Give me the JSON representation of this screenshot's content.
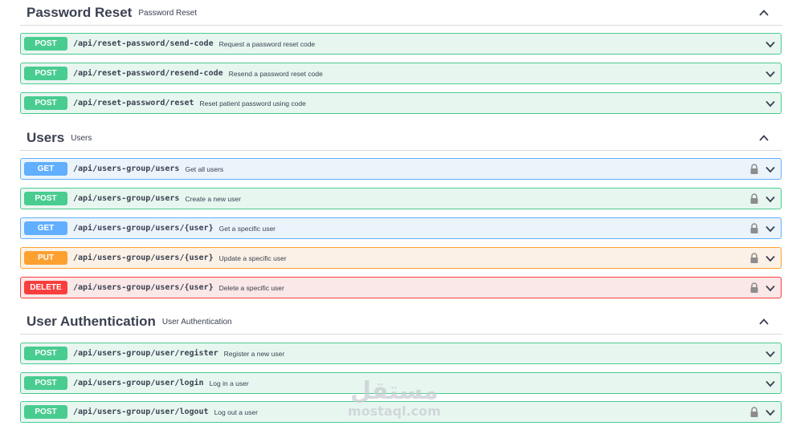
{
  "sections": [
    {
      "title": "Password Reset",
      "description": "Password Reset",
      "operations": [
        {
          "method": "POST",
          "path": "/api/reset-password/send-code",
          "summary": "Request a password reset code",
          "locked": false
        },
        {
          "method": "POST",
          "path": "/api/reset-password/resend-code",
          "summary": "Resend a password reset code",
          "locked": false
        },
        {
          "method": "POST",
          "path": "/api/reset-password/reset",
          "summary": "Reset patient password using code",
          "locked": false
        }
      ]
    },
    {
      "title": "Users",
      "description": "Users",
      "operations": [
        {
          "method": "GET",
          "path": "/api/users-group/users",
          "summary": "Get all users",
          "locked": true
        },
        {
          "method": "POST",
          "path": "/api/users-group/users",
          "summary": "Create a new user",
          "locked": true
        },
        {
          "method": "GET",
          "path": "/api/users-group/users/{user}",
          "summary": "Get a specific user",
          "locked": true
        },
        {
          "method": "PUT",
          "path": "/api/users-group/users/{user}",
          "summary": "Update a specific user",
          "locked": true
        },
        {
          "method": "DELETE",
          "path": "/api/users-group/users/{user}",
          "summary": "Delete a specific user",
          "locked": true
        }
      ]
    },
    {
      "title": "User Authentication",
      "description": "User Authentication",
      "operations": [
        {
          "method": "POST",
          "path": "/api/users-group/user/register",
          "summary": "Register a new user",
          "locked": false
        },
        {
          "method": "POST",
          "path": "/api/users-group/user/login",
          "summary": "Log in a user",
          "locked": false
        },
        {
          "method": "POST",
          "path": "/api/users-group/user/logout",
          "summary": "Log out a user",
          "locked": true
        }
      ]
    }
  ],
  "watermark": {
    "arabic": "مستقل",
    "latin": "mostaql.com"
  },
  "colors": {
    "post": "#49cc90",
    "get": "#61affe",
    "put": "#fca130",
    "delete": "#f93e3e",
    "text": "#3b4151"
  },
  "icons": {
    "collapse": "chevron-up-icon",
    "expand": "chevron-down-icon",
    "lock": "lock-icon"
  }
}
